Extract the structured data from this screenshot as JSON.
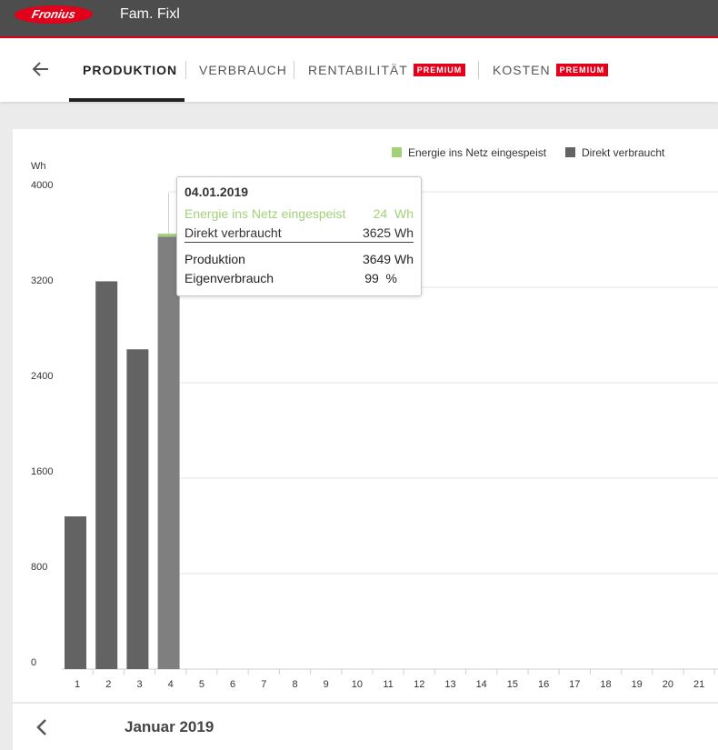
{
  "header": {
    "logo_text": "Fronius",
    "site_name": "Fam. Fixl"
  },
  "nav": {
    "tabs": [
      {
        "label": "PRODUKTION",
        "active": true
      },
      {
        "label": "VERBRAUCH"
      },
      {
        "label": "RENTABILITÄT",
        "badge": "PREMIUM"
      },
      {
        "label": "KOSTEN",
        "badge": "PREMIUM"
      }
    ]
  },
  "chart_data": {
    "type": "bar",
    "ylabel": "Wh",
    "ylim": [
      0,
      4000
    ],
    "yticks": [
      "0",
      "800",
      "1600",
      "2400",
      "3200",
      "4000"
    ],
    "categories": [
      "1",
      "2",
      "3",
      "4",
      "5",
      "6",
      "7",
      "8",
      "9",
      "10",
      "11",
      "12",
      "13",
      "14",
      "15",
      "16",
      "17",
      "18",
      "19",
      "20",
      "21"
    ],
    "stacked": true,
    "legend_position": "top-right",
    "series": [
      {
        "name": "Energie ins Netz eingespeist",
        "color": "#a3d17a",
        "values": [
          0,
          0,
          0,
          24,
          null,
          null,
          null,
          null,
          null,
          null,
          null,
          null,
          null,
          null,
          null,
          null,
          null,
          null,
          null,
          null,
          null
        ]
      },
      {
        "name": "Direkt verbraucht",
        "color": "#636363",
        "values": [
          1280,
          3250,
          2680,
          3625,
          null,
          null,
          null,
          null,
          null,
          null,
          null,
          null,
          null,
          null,
          null,
          null,
          null,
          null,
          null,
          null,
          null
        ]
      }
    ],
    "highlight_index": 3
  },
  "tooltip": {
    "date": "04.01.2019",
    "rows": [
      {
        "label": "Energie ins Netz eingespeist",
        "value": "24",
        "unit": "Wh"
      },
      {
        "label": "Direkt verbraucht",
        "value": "3625",
        "unit": "Wh"
      },
      {
        "label": "Produktion",
        "value": "3649",
        "unit": "Wh"
      },
      {
        "label": "Eigenverbrauch",
        "value": "99",
        "unit": "%"
      }
    ]
  },
  "footer": {
    "month": "Januar 2019"
  }
}
